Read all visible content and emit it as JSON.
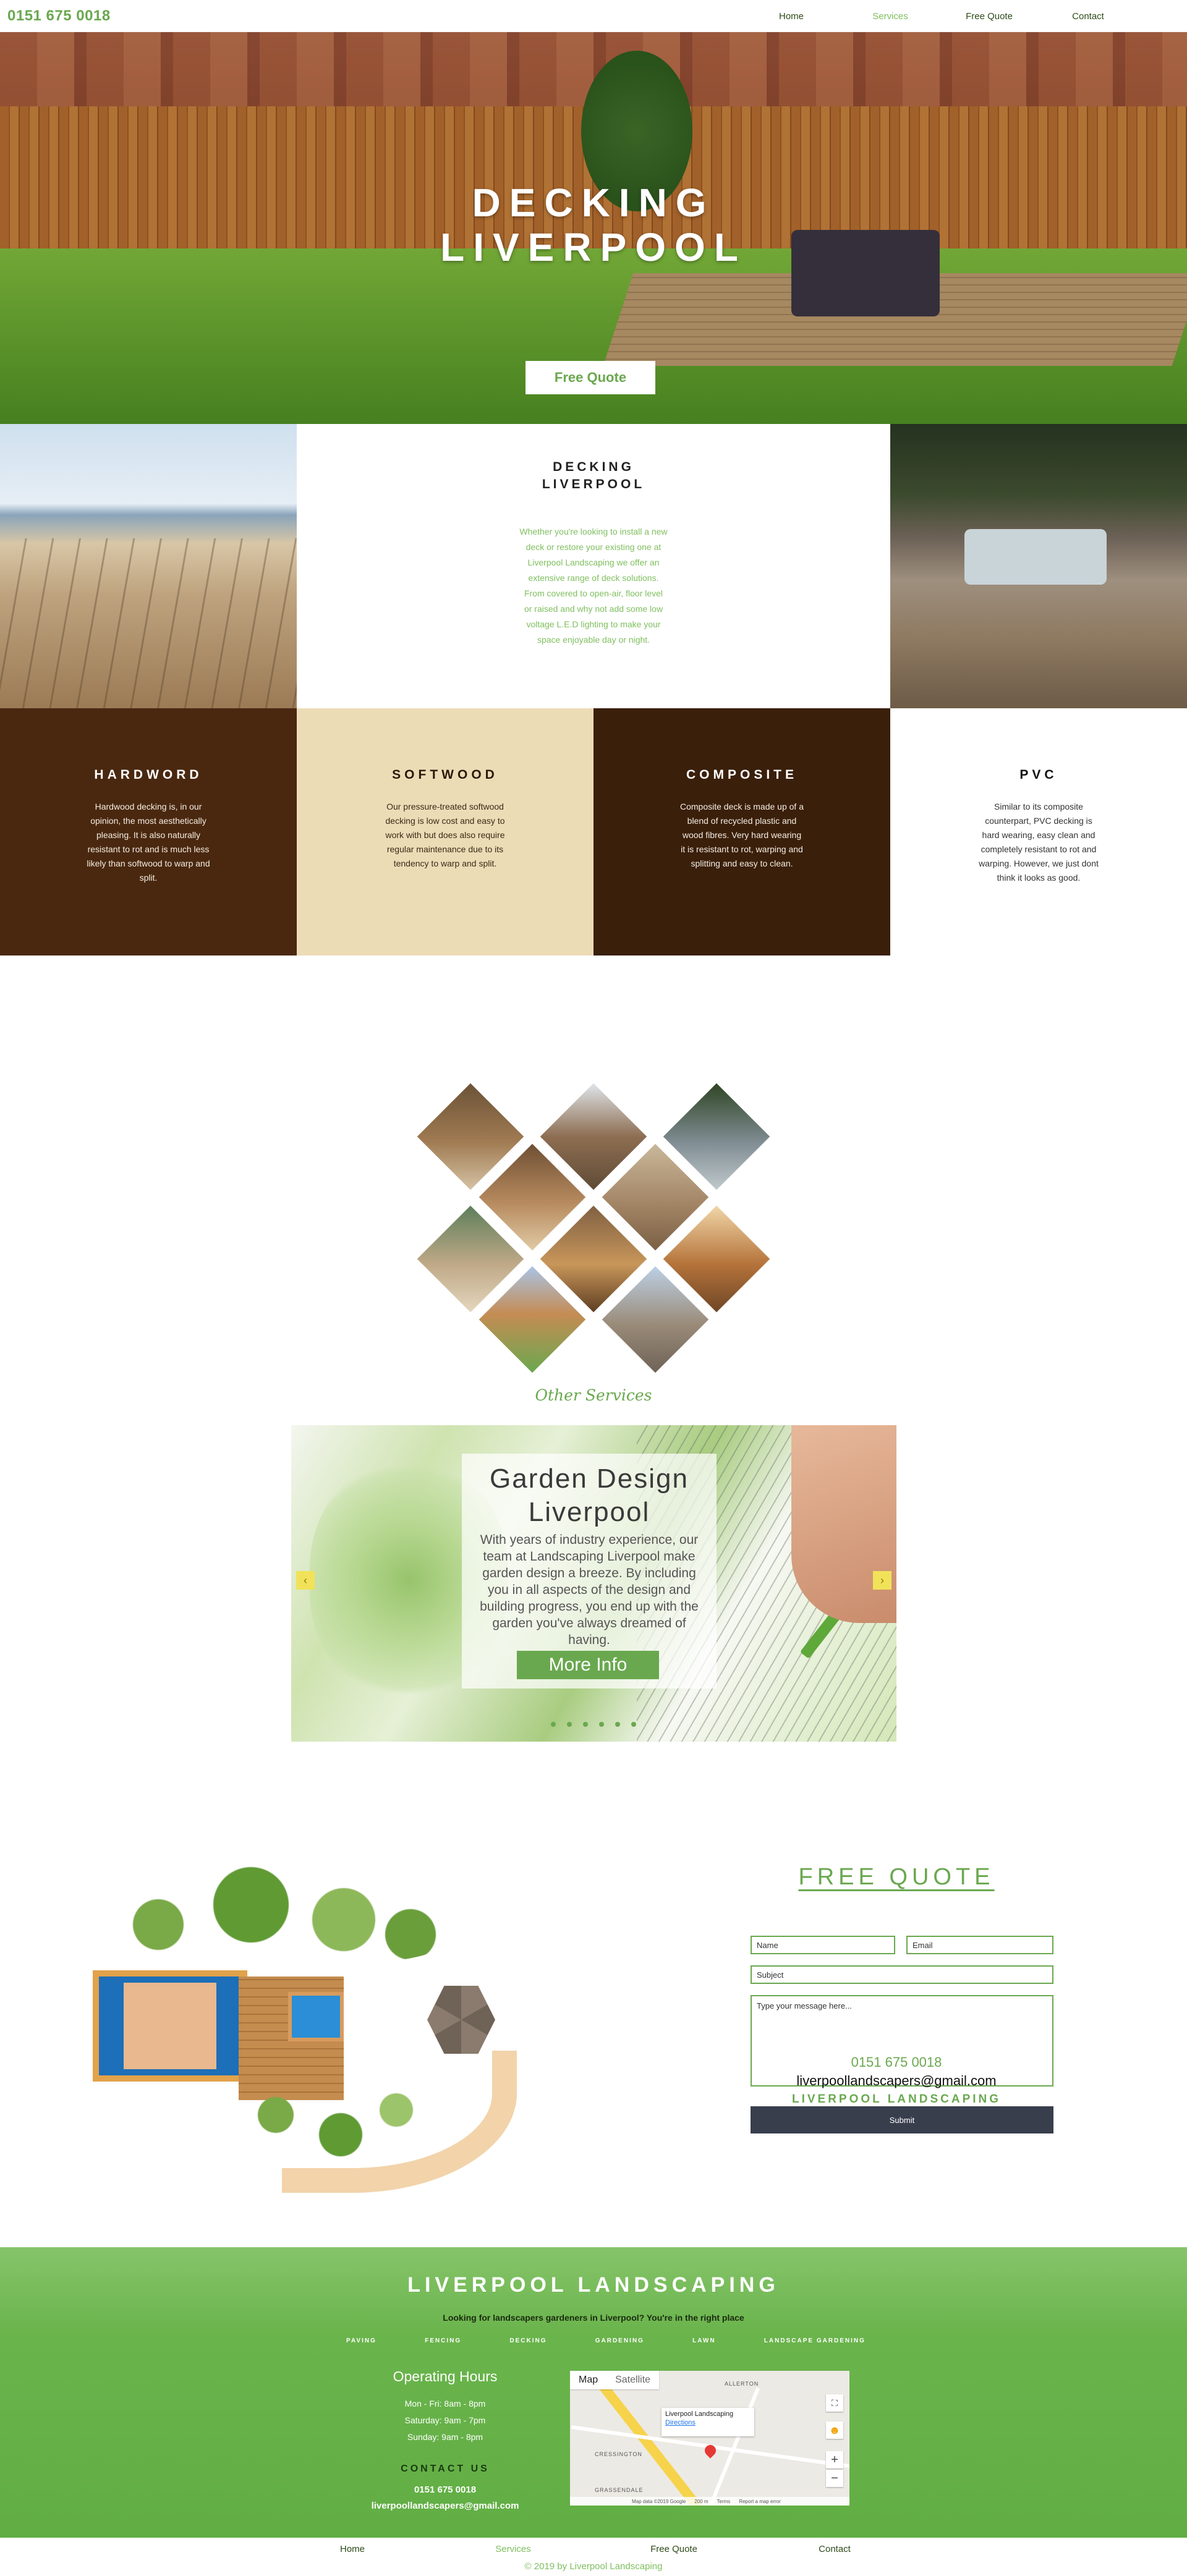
{
  "header": {
    "phone": "0151 675 0018",
    "nav": [
      {
        "label": "Home",
        "active": false
      },
      {
        "label": "Services",
        "active": true
      },
      {
        "label": "Free Quote",
        "active": false
      },
      {
        "label": "Contact",
        "active": false
      }
    ]
  },
  "hero": {
    "title_line1": "DECKING",
    "title_line2": "LIVERPOOL",
    "button": "Free Quote"
  },
  "intro": {
    "title_line1": "DECKING",
    "title_line2": "LIVERPOOL",
    "body": "Whether you're looking to install a new deck or restore your existing one at Liverpool Landscaping we offer an extensive range of deck solutions. From covered to open-air, floor level or raised and why not add some low voltage L.E.D lighting to make your space enjoyable day or night."
  },
  "materials": [
    {
      "title": "HARDWORD",
      "body": "Hardwood decking is, in our opinion, the most aesthetically pleasing. It is also naturally resistant to rot and is much less likely than softwood to warp and split."
    },
    {
      "title": "SOFTWOOD",
      "body": "Our pressure-treated softwood decking is low cost and easy to work with but does also require regular maintenance due to its tendency to warp and split."
    },
    {
      "title": "COMPOSITE",
      "body": "Composite deck is made up of a blend of recycled plastic and wood fibres. Very hard wearing it is resistant to rot, warping and splitting and easy to clean."
    },
    {
      "title": "PVC",
      "body": "Similar to its composite counterpart, PVC decking is hard wearing, easy clean and completely resistant to rot and warping. However, we just dont think it looks as good."
    }
  ],
  "other_services": {
    "title": "Other Services",
    "slide": {
      "title_line1": "Garden Design",
      "title_line2": "Liverpool",
      "body": "With years of industry experience, our team at Landscaping Liverpool make garden design a breeze. By including you in all aspects of the design and building progress, you end up with the garden you've always dreamed of having.",
      "button": "More Info"
    },
    "arrows": {
      "prev": "‹",
      "next": "›"
    }
  },
  "quote": {
    "title": "FREE QUOTE",
    "placeholders": {
      "name": "Name",
      "email": "Email",
      "subject": "Subject",
      "message": "Type your message here..."
    },
    "submit": "Submit",
    "phone": "0151 675 0018",
    "email": "liverpoollandscapers@gmail.com",
    "brand": "LIVERPOOL LANDSCAPING"
  },
  "footer": {
    "title": "LIVERPOOL LANDSCAPING",
    "tagline": "Looking for landscapers gardeners in Liverpool? You're in the right place",
    "service_links": [
      "PAVING",
      "FENCING",
      "DECKING",
      "GARDENING",
      "LAWN",
      "LANDSCAPE GARDENING"
    ],
    "hours_title": "Operating Hours",
    "hours": [
      "Mon - Fri: 8am - 8pm",
      "Saturday: 9am - 7pm",
      "Sunday: 9am - 8pm"
    ],
    "contact_title": "CONTACT US",
    "phone": "0151 675 0018",
    "email": "liverpoollandscapers@gmail.com",
    "map": {
      "tab_map": "Map",
      "tab_satellite": "Satellite",
      "place": "Liverpool Landscaping",
      "directions": "Directions",
      "labels": [
        "ALLERTON",
        "CRESSINGTON",
        "GRASSENDALE"
      ],
      "attribution": [
        "Map data ©2019 Google",
        "200 m",
        "Terms",
        "Report a map error"
      ]
    }
  },
  "bottom_nav": [
    {
      "label": "Home",
      "active": false
    },
    {
      "label": "Services",
      "active": true
    },
    {
      "label": "Free Quote",
      "active": false
    },
    {
      "label": "Contact",
      "active": false
    }
  ],
  "copyright": "© 2019 by Liverpool Landscaping",
  "colors": {
    "brand_green": "#6aa84f",
    "light_green": "#7fbf5f",
    "hardwood_brown": "#4a2810",
    "softwood_beige": "#ecdcb6",
    "composite_brown": "#3a1f0b",
    "submit_dark": "#393e4d"
  }
}
